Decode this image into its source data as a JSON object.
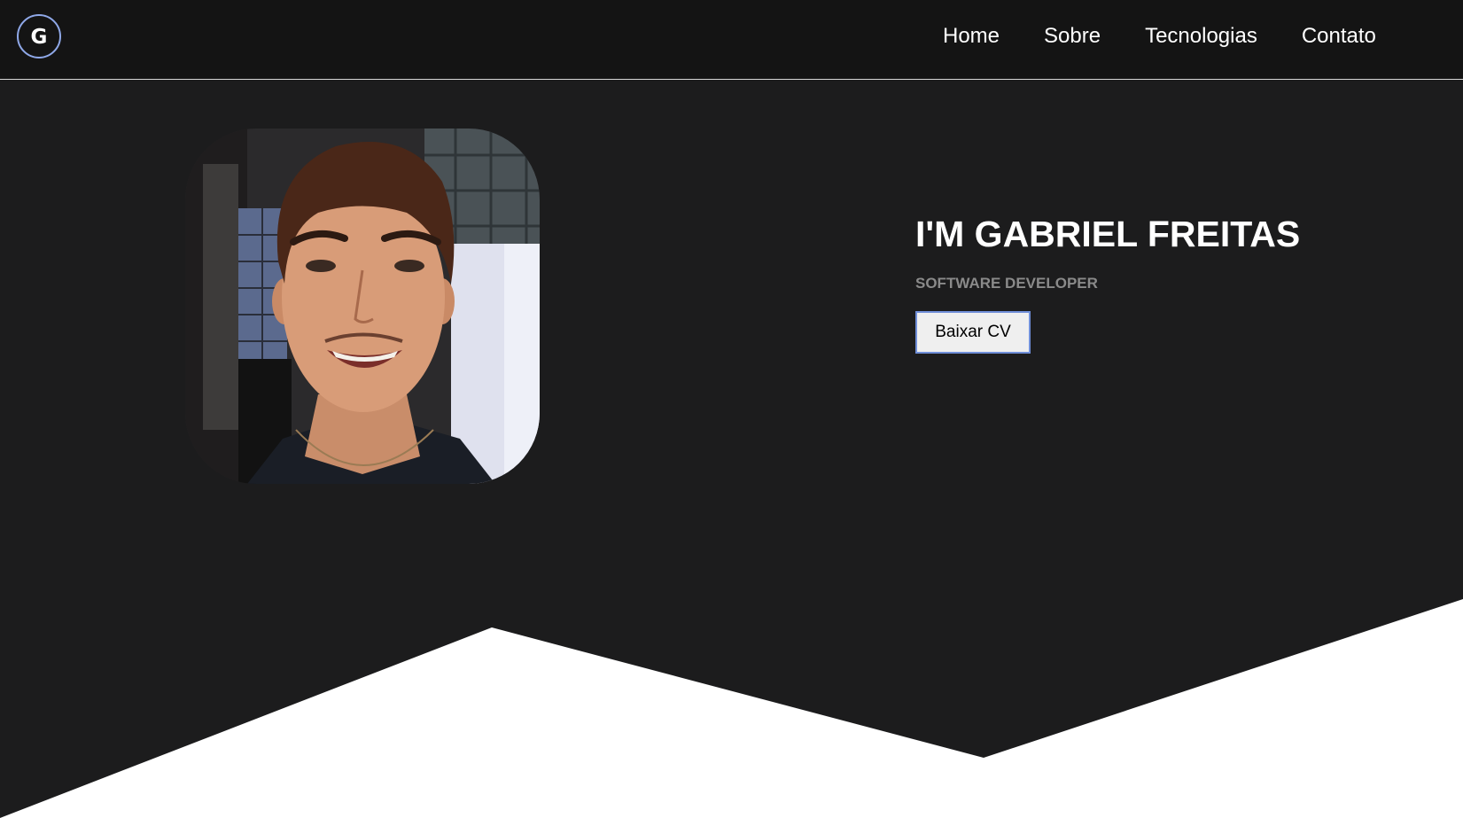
{
  "header": {
    "logo_letter": "G",
    "logo_icon": "logo-g-icon",
    "accent_color": "#8fa8e8",
    "nav": {
      "home": "Home",
      "sobre": "Sobre",
      "tecnologias": "Tecnologias",
      "contato": "Contato"
    }
  },
  "hero": {
    "title": "I'M GABRIEL FREITAS",
    "subtitle": "SOFTWARE DEVELOPER",
    "cv_button": "Baixar CV",
    "photo_alt": "profile photo"
  },
  "colors": {
    "background": "#1c1c1d",
    "header_background": "#141414",
    "bottom_shape": "#ffffff",
    "button_border": "#6f8ed8"
  }
}
